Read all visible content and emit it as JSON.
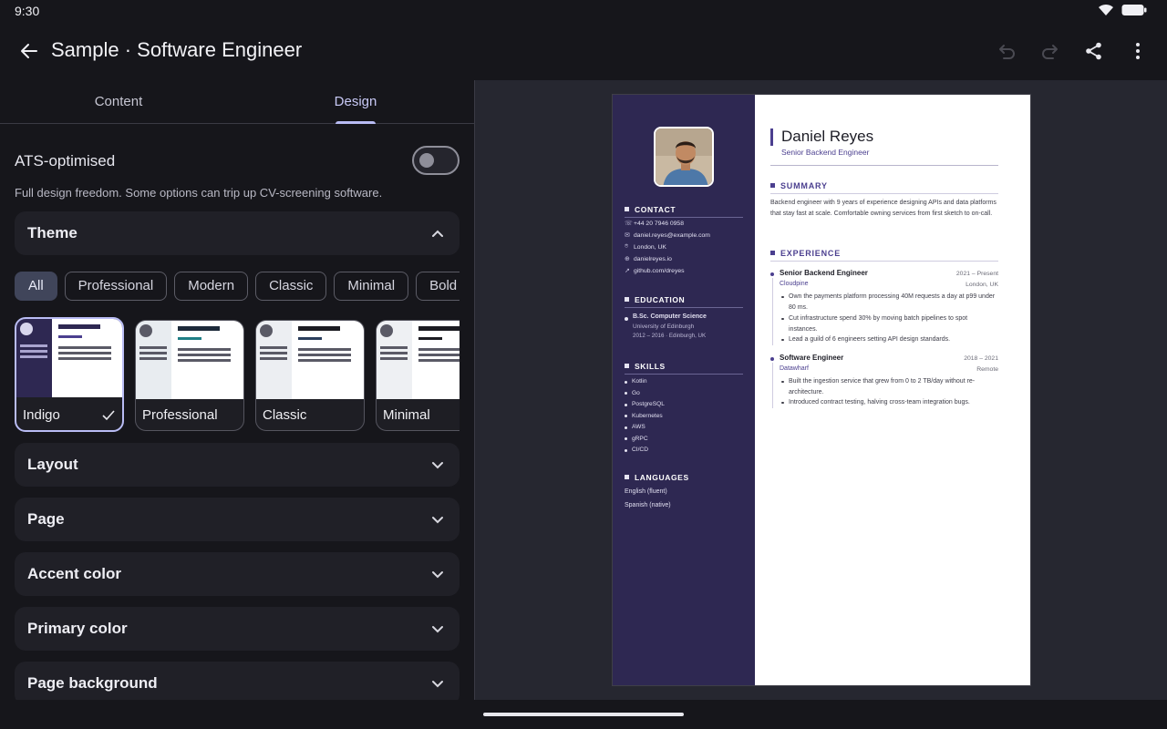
{
  "status": {
    "time": "9:30"
  },
  "app_bar": {
    "title": "Sample · Software Engineer"
  },
  "tabs": [
    {
      "label": "Content"
    },
    {
      "label": "Design"
    }
  ],
  "ats": {
    "label": "ATS-optimised",
    "enabled": false,
    "description": "Full design freedom. Some options can trip up CV-screening software."
  },
  "sections": {
    "theme": "Theme",
    "layout": "Layout",
    "page": "Page",
    "accent_color": "Accent color",
    "primary_color": "Primary color",
    "page_background": "Page background"
  },
  "theme_filters": [
    "All",
    "Professional",
    "Modern",
    "Classic",
    "Minimal",
    "Bold"
  ],
  "selected_filter": "All",
  "themes": [
    {
      "name": "Indigo",
      "selected": true,
      "side_color": "#2e2852",
      "accent_color": "#4b3f8f",
      "top_bar_color": "#2e2852"
    },
    {
      "name": "Professional",
      "selected": false,
      "side_color": "#e8ecf0",
      "accent_color": "#1f7f86",
      "top_bar_color": "#1d2a3a"
    },
    {
      "name": "Classic",
      "selected": false,
      "side_color": "#eceef2",
      "accent_color": "#2b3f5c",
      "top_bar_color": "#1c1c22"
    },
    {
      "name": "Minimal",
      "selected": false,
      "side_color": "#eef0f3",
      "accent_color": "#1c1c22",
      "top_bar_color": "#1c1c22"
    }
  ],
  "resume": {
    "name": "Daniel Reyes",
    "title": "Senior Backend Engineer",
    "contact_heading": "CONTACT",
    "contact": [
      {
        "icon": "phone-icon",
        "glyph": "☏",
        "text": "+44 20 7946 0958"
      },
      {
        "icon": "mail-icon",
        "glyph": "✉",
        "text": "daniel.reyes@example.com"
      },
      {
        "icon": "location-icon",
        "glyph": "⌾",
        "text": "London, UK"
      },
      {
        "icon": "globe-icon",
        "glyph": "⊕",
        "text": "danielreyes.io"
      },
      {
        "icon": "link-icon",
        "glyph": "↗",
        "text": "github.com/dreyes"
      }
    ],
    "education_heading": "EDUCATION",
    "education": {
      "degree": "B.Sc. Computer Science",
      "school": "University of Edinburgh",
      "details": "2012 – 2016 · Edinburgh, UK"
    },
    "skills_heading": "SKILLS",
    "skills": [
      "Kotlin",
      "Go",
      "PostgreSQL",
      "Kubernetes",
      "AWS",
      "gRPC",
      "CI/CD"
    ],
    "languages_heading": "LANGUAGES",
    "languages": [
      "English (fluent)",
      "Spanish (native)"
    ],
    "summary_heading": "SUMMARY",
    "summary": "Backend engineer with 9 years of experience designing APIs and data platforms that stay fast at scale. Comfortable owning services from first sketch to on-call.",
    "experience_heading": "EXPERIENCE",
    "experience": [
      {
        "role": "Senior Backend Engineer",
        "dates": "2021 – Present",
        "company": "Cloudpine",
        "location": "London, UK",
        "bullets": [
          "Own the payments platform processing 40M requests a day at p99 under 80 ms.",
          "Cut infrastructure spend 30% by moving batch pipelines to spot instances.",
          "Lead a guild of 6 engineers setting API design standards."
        ]
      },
      {
        "role": "Software Engineer",
        "dates": "2018 – 2021",
        "company": "Datawharf",
        "location": "Remote",
        "bullets": [
          "Built the ingestion service that grew from 0 to 2 TB/day without re-architecture.",
          "Introduced contract testing, halving cross-team integration bugs."
        ]
      }
    ]
  }
}
